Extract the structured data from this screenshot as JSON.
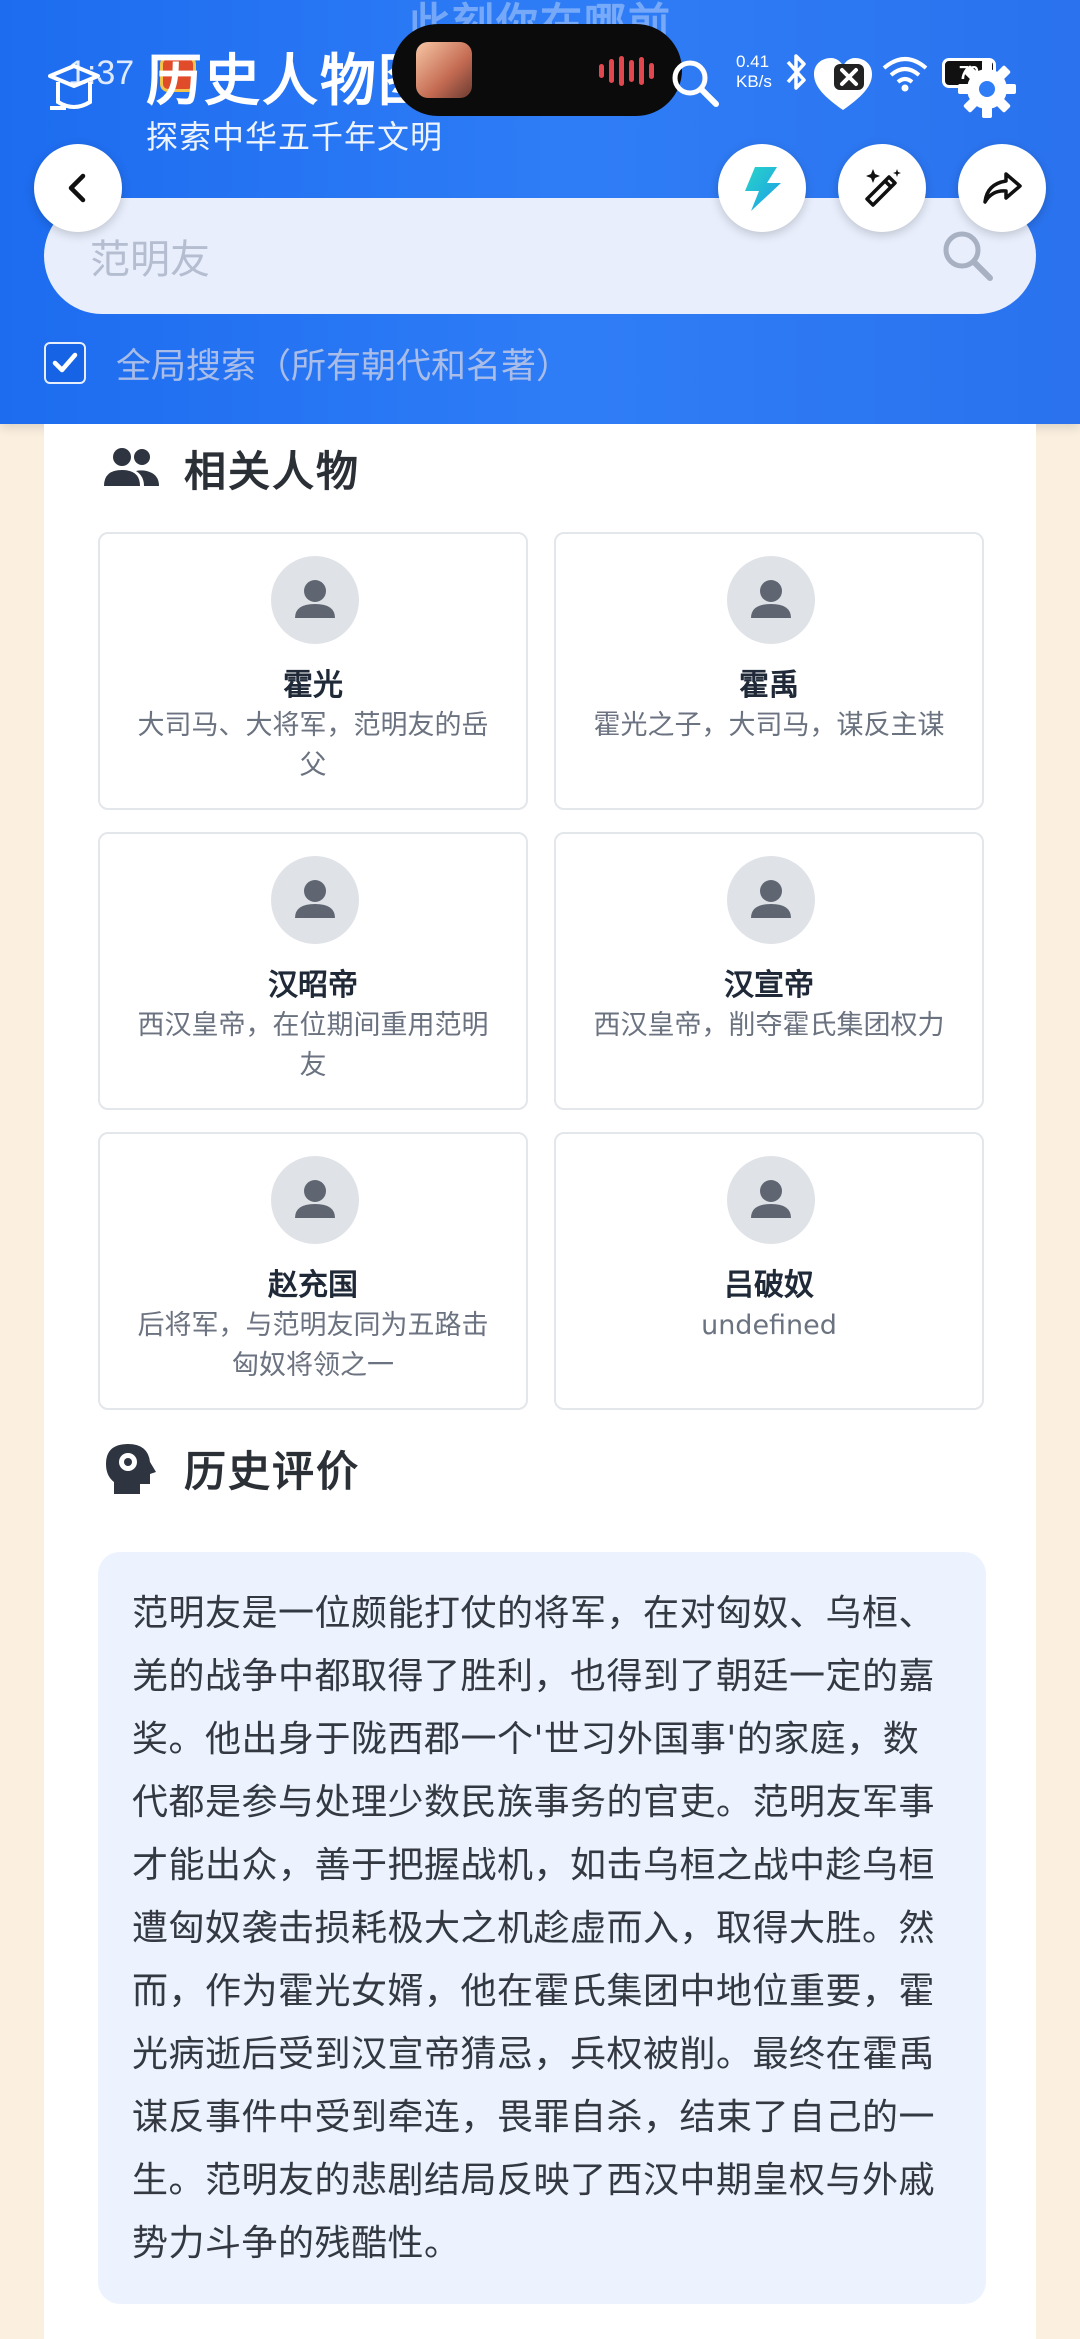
{
  "status_bar": {
    "time": "1:37",
    "net_speed_value": "0.41",
    "net_speed_unit": "KB/s",
    "battery": "79"
  },
  "header": {
    "ghost_title": "此刻你在哪前",
    "title": "历史人物图",
    "subtitle": "探索中华五千年文明"
  },
  "search": {
    "value": "范明友",
    "global_checked": true,
    "global_label": "全局搜索（所有朝代和名著）"
  },
  "related": {
    "title": "相关人物",
    "people": [
      {
        "name": "霍光",
        "desc": "大司马、大将军，范明友的岳父"
      },
      {
        "name": "霍禹",
        "desc": "霍光之子，大司马，谋反主谋"
      },
      {
        "name": "汉昭帝",
        "desc": "西汉皇帝，在位期间重用范明友"
      },
      {
        "name": "汉宣帝",
        "desc": "西汉皇帝，削夺霍氏集团权力"
      },
      {
        "name": "赵充国",
        "desc": "后将军，与范明友同为五路击匈奴将领之一"
      },
      {
        "name": "吕破奴",
        "desc": "undefined"
      }
    ]
  },
  "evaluation": {
    "title": "历史评价",
    "text": "范明友是一位颇能打仗的将军，在对匈奴、乌桓、羌的战争中都取得了胜利，也得到了朝廷一定的嘉奖。他出身于陇西郡一个'世习外国事'的家庭，数代都是参与处理少数民族事务的官吏。范明友军事才能出众，善于把握战机，如击乌桓之战中趁乌桓遭匈奴袭击损耗极大之机趁虚而入，取得大胜。然而，作为霍光女婿，他在霍氏集团中地位重要，霍光病逝后受到汉宣帝猜忌，兵权被削。最终在霍禹谋反事件中受到牵连，畏罪自杀，结束了自己的一生。范明友的悲剧结局反映了西汉中期皇权与外戚势力斗争的残酷性。"
  }
}
